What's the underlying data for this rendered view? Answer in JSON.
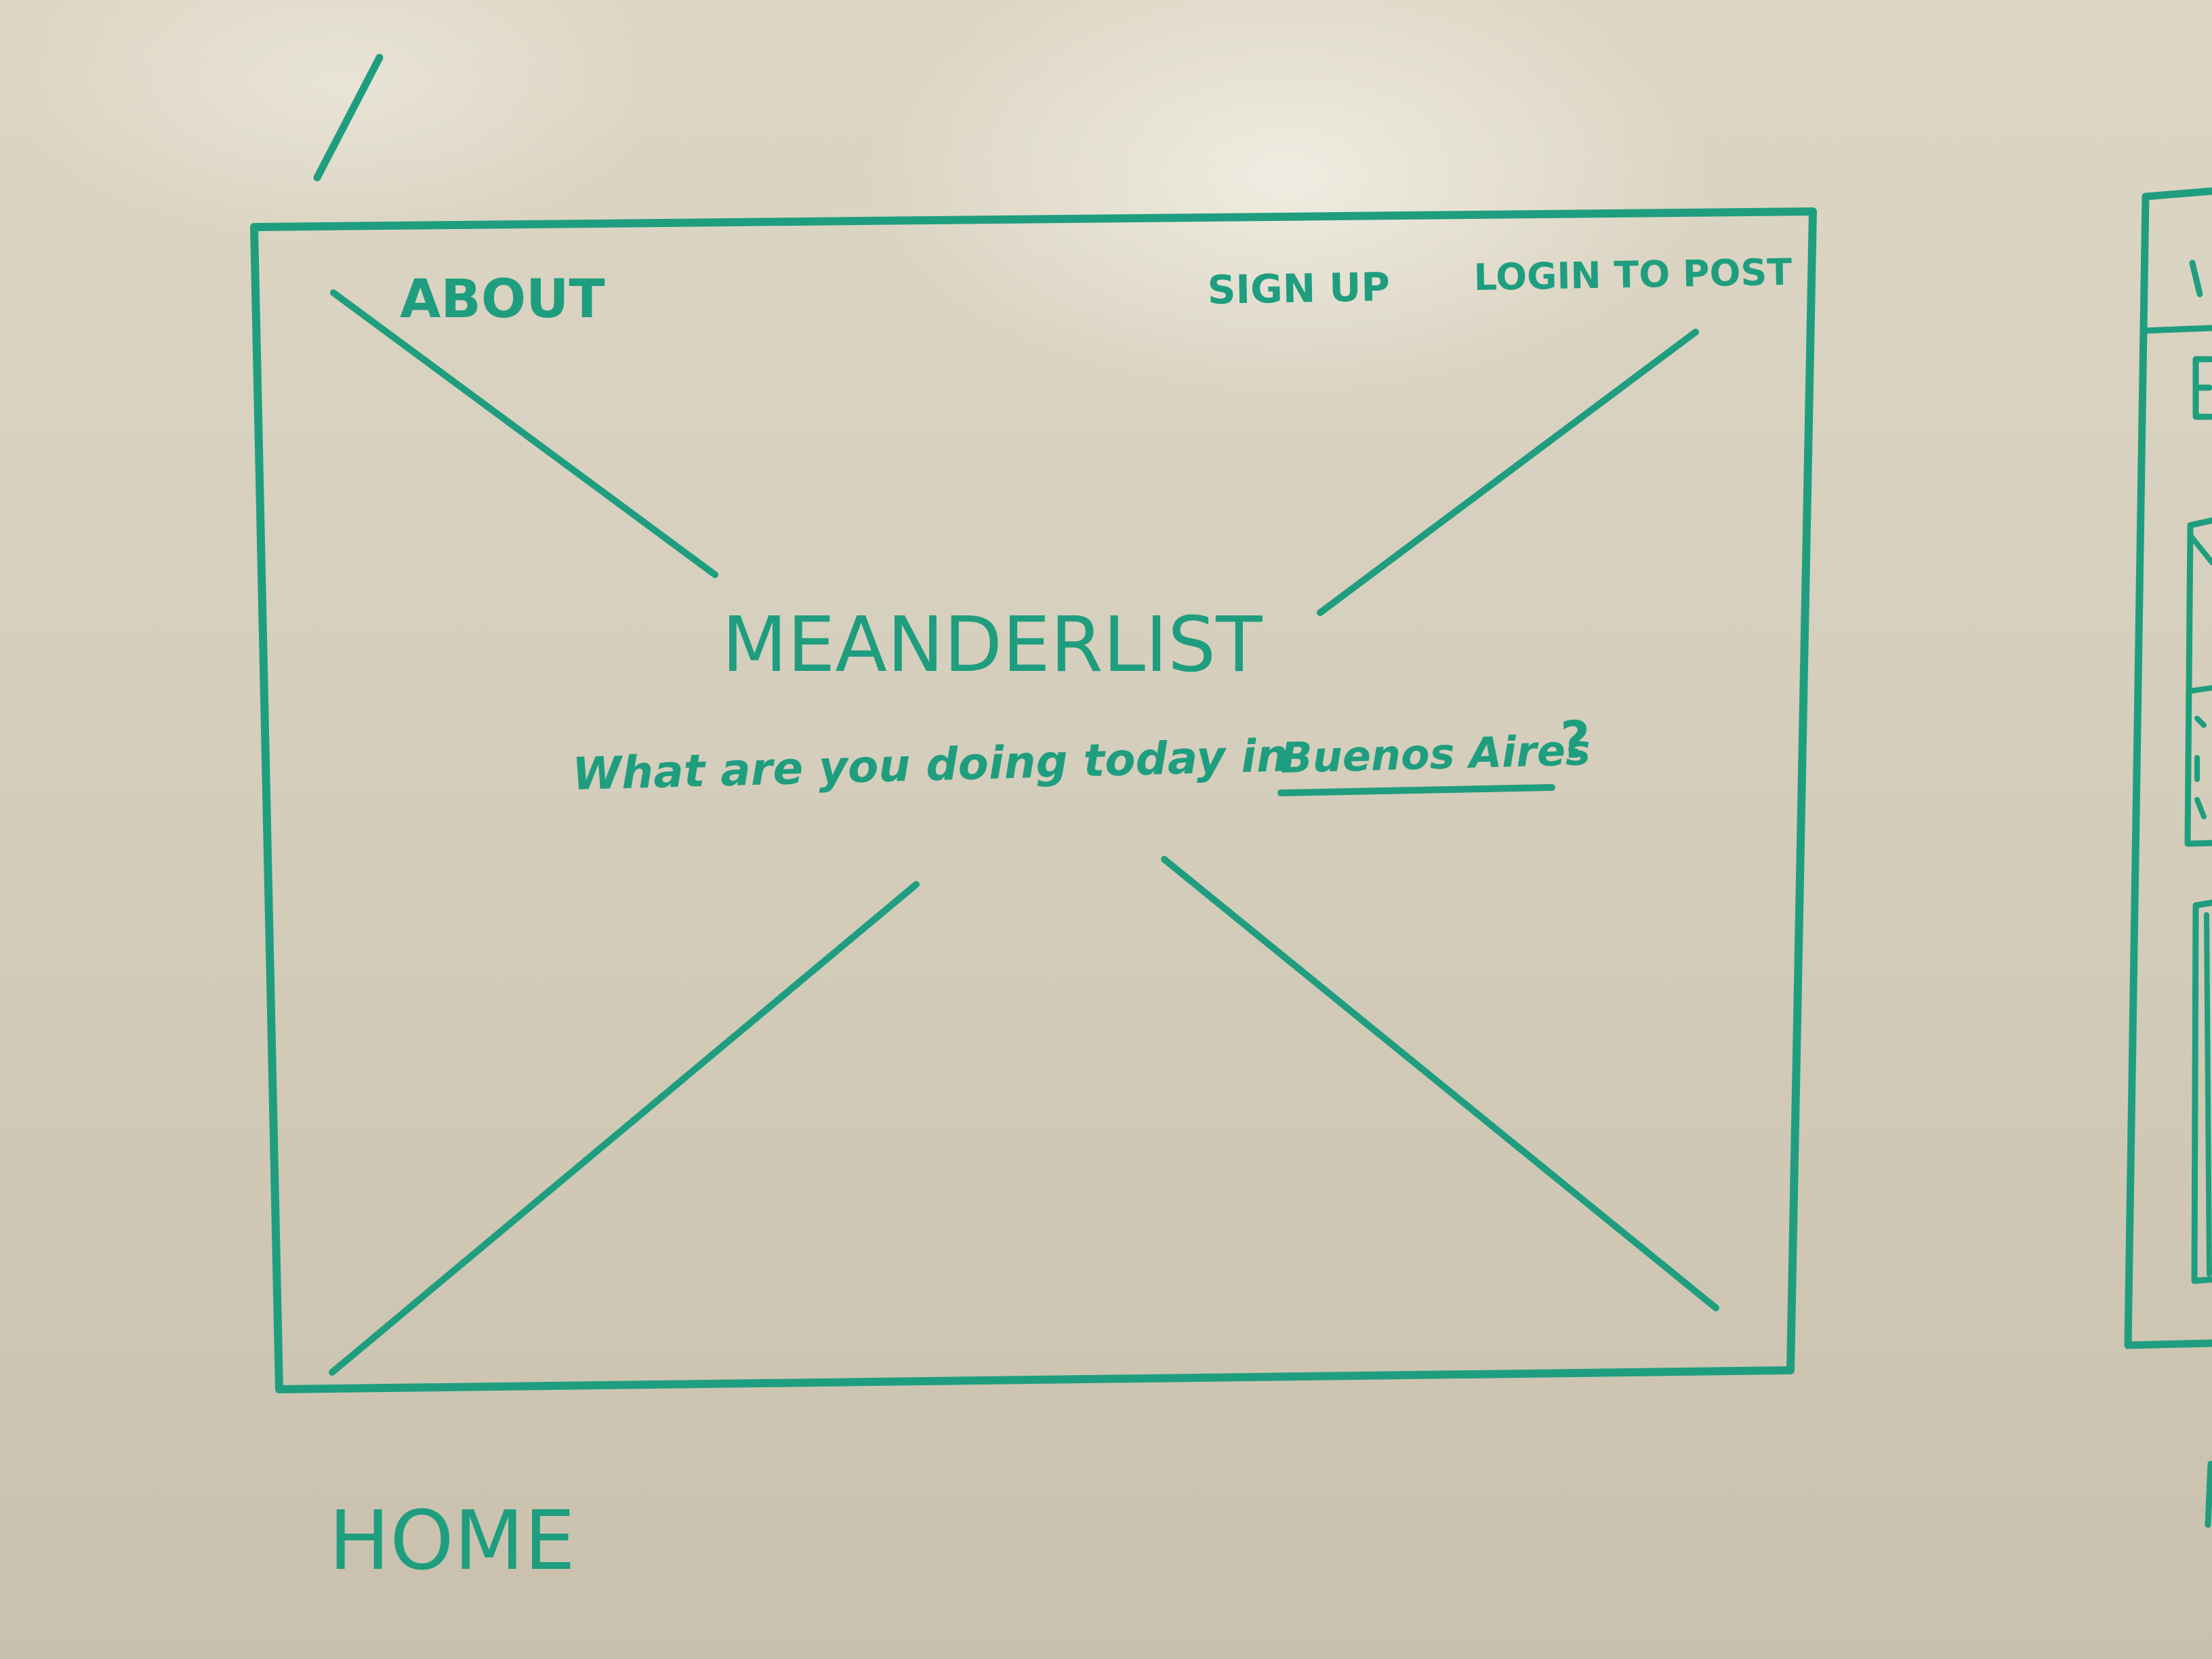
{
  "nav": {
    "about": "ABOUT",
    "sign_up": "SIGN UP",
    "login": "LOGIN TO POST"
  },
  "hero": {
    "title": "MEANDERLIST",
    "question_prefix": "What are you doing today in",
    "city": "Buenos Aires",
    "question_suffix": "?"
  },
  "page_label": "HOME",
  "colors": {
    "marker": "#1f9e7f",
    "whiteboard": "#d6cfbd"
  }
}
